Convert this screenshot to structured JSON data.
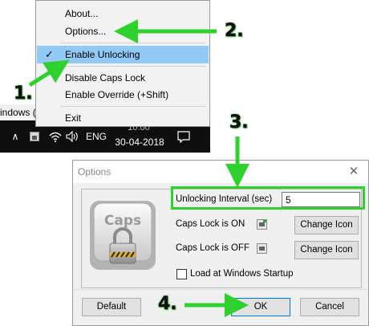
{
  "background_window": {
    "partial_title": "indows (C"
  },
  "context_menu": {
    "items": [
      {
        "label": "About..."
      },
      {
        "label": "Options..."
      },
      {
        "label": "Enable Unlocking",
        "checked": true,
        "selected": true
      },
      {
        "label": "Disable Caps Lock"
      },
      {
        "label": "Enable Override (+Shift)"
      },
      {
        "label": "Exit"
      }
    ],
    "check_glyph": "✓"
  },
  "taskbar": {
    "chevron_glyph": "∧",
    "icons": [
      "chevron-up-icon",
      "caps-unlocker-tray-icon",
      "wifi-icon",
      "volume-icon",
      "action-center-icon"
    ],
    "language": "ENG",
    "time_partial": "10:00",
    "date": "30-04-2018"
  },
  "dialog": {
    "title": "Options",
    "close_glyph": "✕",
    "key_label": "Caps",
    "unlocking_interval_label": "Unlocking Interval (sec)",
    "unlocking_interval_value": "5",
    "caps_on_label": "Caps Lock is ON",
    "caps_off_label": "Caps Lock is OFF",
    "change_icon_label": "Change Icon",
    "load_at_startup_label": "Load at Windows Startup",
    "load_at_startup_checked": false,
    "default_label": "Default",
    "ok_label": "OK",
    "cancel_label": "Cancel"
  },
  "annotations": {
    "steps": [
      "1.",
      "2.",
      "3.",
      "4."
    ],
    "accent_color": "#2fd12f"
  }
}
